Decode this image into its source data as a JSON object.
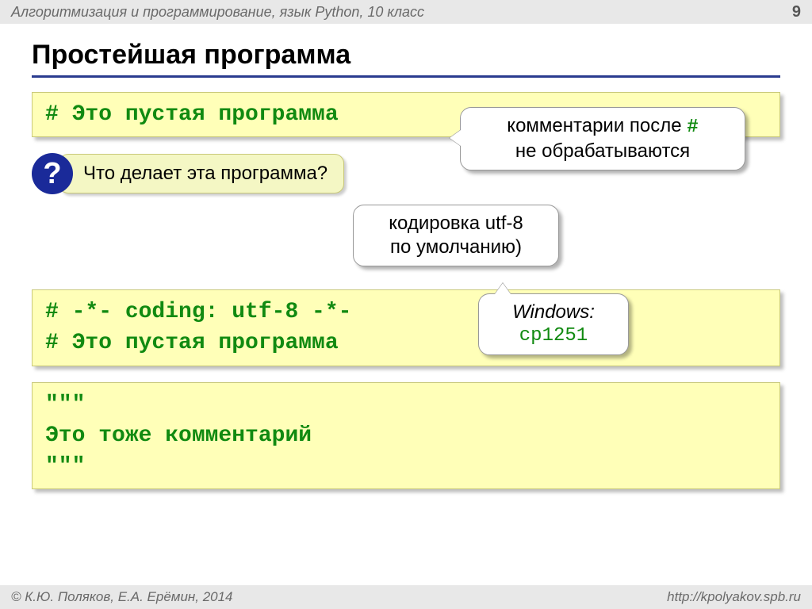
{
  "header": {
    "breadcrumb": "Алгоритмизация и программирование, язык Python, 10 класс",
    "page_number": "9"
  },
  "title": "Простейшая программа",
  "code1": "# Это пустая программа",
  "question": {
    "mark": "?",
    "text": "Что делает эта программа?"
  },
  "callout_comments": {
    "line1_pre": "комментарии после ",
    "line1_hash": "#",
    "line2": "не обрабатываются"
  },
  "callout_encoding": {
    "line1": "кодировка utf-8",
    "line2": "по умолчанию)"
  },
  "code2": {
    "line1": "# -*- coding: utf-8 -*-",
    "line2": "# Это пустая программа"
  },
  "callout_windows": {
    "label": "Windows:",
    "value": "cp1251"
  },
  "code3": {
    "line1": "\"\"\"",
    "line2": "Это тоже комментарий",
    "line3": "\"\"\""
  },
  "footer": {
    "left": "© К.Ю. Поляков, Е.А. Ерёмин, 2014",
    "right": "http://kpolyakov.spb.ru"
  }
}
